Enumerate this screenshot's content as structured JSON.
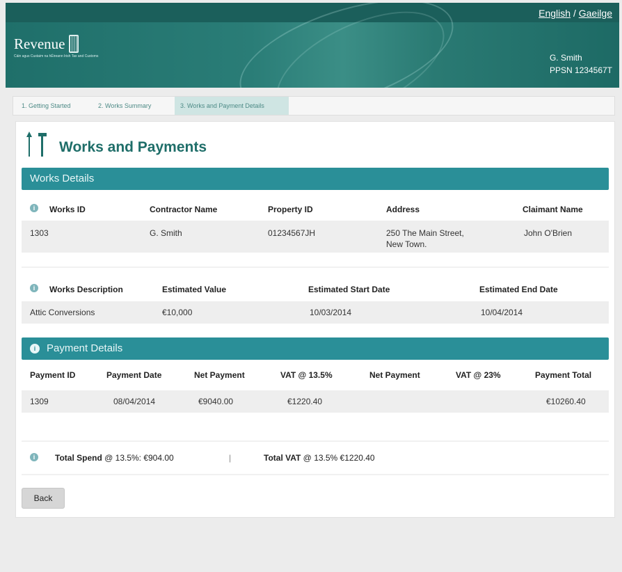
{
  "header": {
    "lang_english": "English",
    "lang_separator": "/",
    "lang_irish": "Gaeilge",
    "logo_text": "Revenue",
    "logo_sub": "Cáin agus Custaim na hÉireann Irish Tax and Customs",
    "user_name": "G. Smith",
    "user_ppsn": "PPSN 1234567T"
  },
  "tabs": [
    {
      "label": "1. Getting Started"
    },
    {
      "label": "2. Works Summary"
    },
    {
      "label": "3. Works and Payment Details"
    }
  ],
  "page": {
    "title": "Works and Payments"
  },
  "works": {
    "section_title": "Works Details",
    "headers": [
      "Works ID",
      "Contractor Name",
      "Property ID",
      "Address",
      "Claimant Name"
    ],
    "row": {
      "works_id": "1303",
      "contractor": "G. Smith",
      "property_id": "01234567JH",
      "address_line1": "250 The Main Street,",
      "address_line2": "New Town.",
      "claimant": "John O'Brien"
    },
    "headers2": [
      "Works Description",
      "Estimated Value",
      "Estimated Start Date",
      "Estimated End Date"
    ],
    "row2": {
      "description": "Attic Conversions",
      "value": "€10,000",
      "start": "10/03/2014",
      "end": "10/04/2014"
    }
  },
  "payments": {
    "section_title": "Payment Details",
    "headers": [
      "Payment ID",
      "Payment Date",
      "Net Payment",
      "VAT @ 13.5%",
      "Net Payment",
      "VAT @ 23%",
      "Payment Total"
    ],
    "row": {
      "payment_id": "1309",
      "date": "08/04/2014",
      "net": "€9040.00",
      "vat135": "€1220.40",
      "net23": "",
      "vat23": "",
      "total": "€10260.40"
    },
    "total_spend_label": "Total Spend",
    "total_spend_value": "@ 13.5%: €904.00",
    "separator": "|",
    "total_vat_label": "Total VAT",
    "total_vat_value": "@ 13.5% €1220.40"
  },
  "buttons": {
    "back": "Back"
  },
  "colors": {
    "header_teal": "#1f6f6a",
    "section_bar": "#2a8f98",
    "title_teal": "#1f6e69",
    "active_tab": "#cfe5e3"
  }
}
